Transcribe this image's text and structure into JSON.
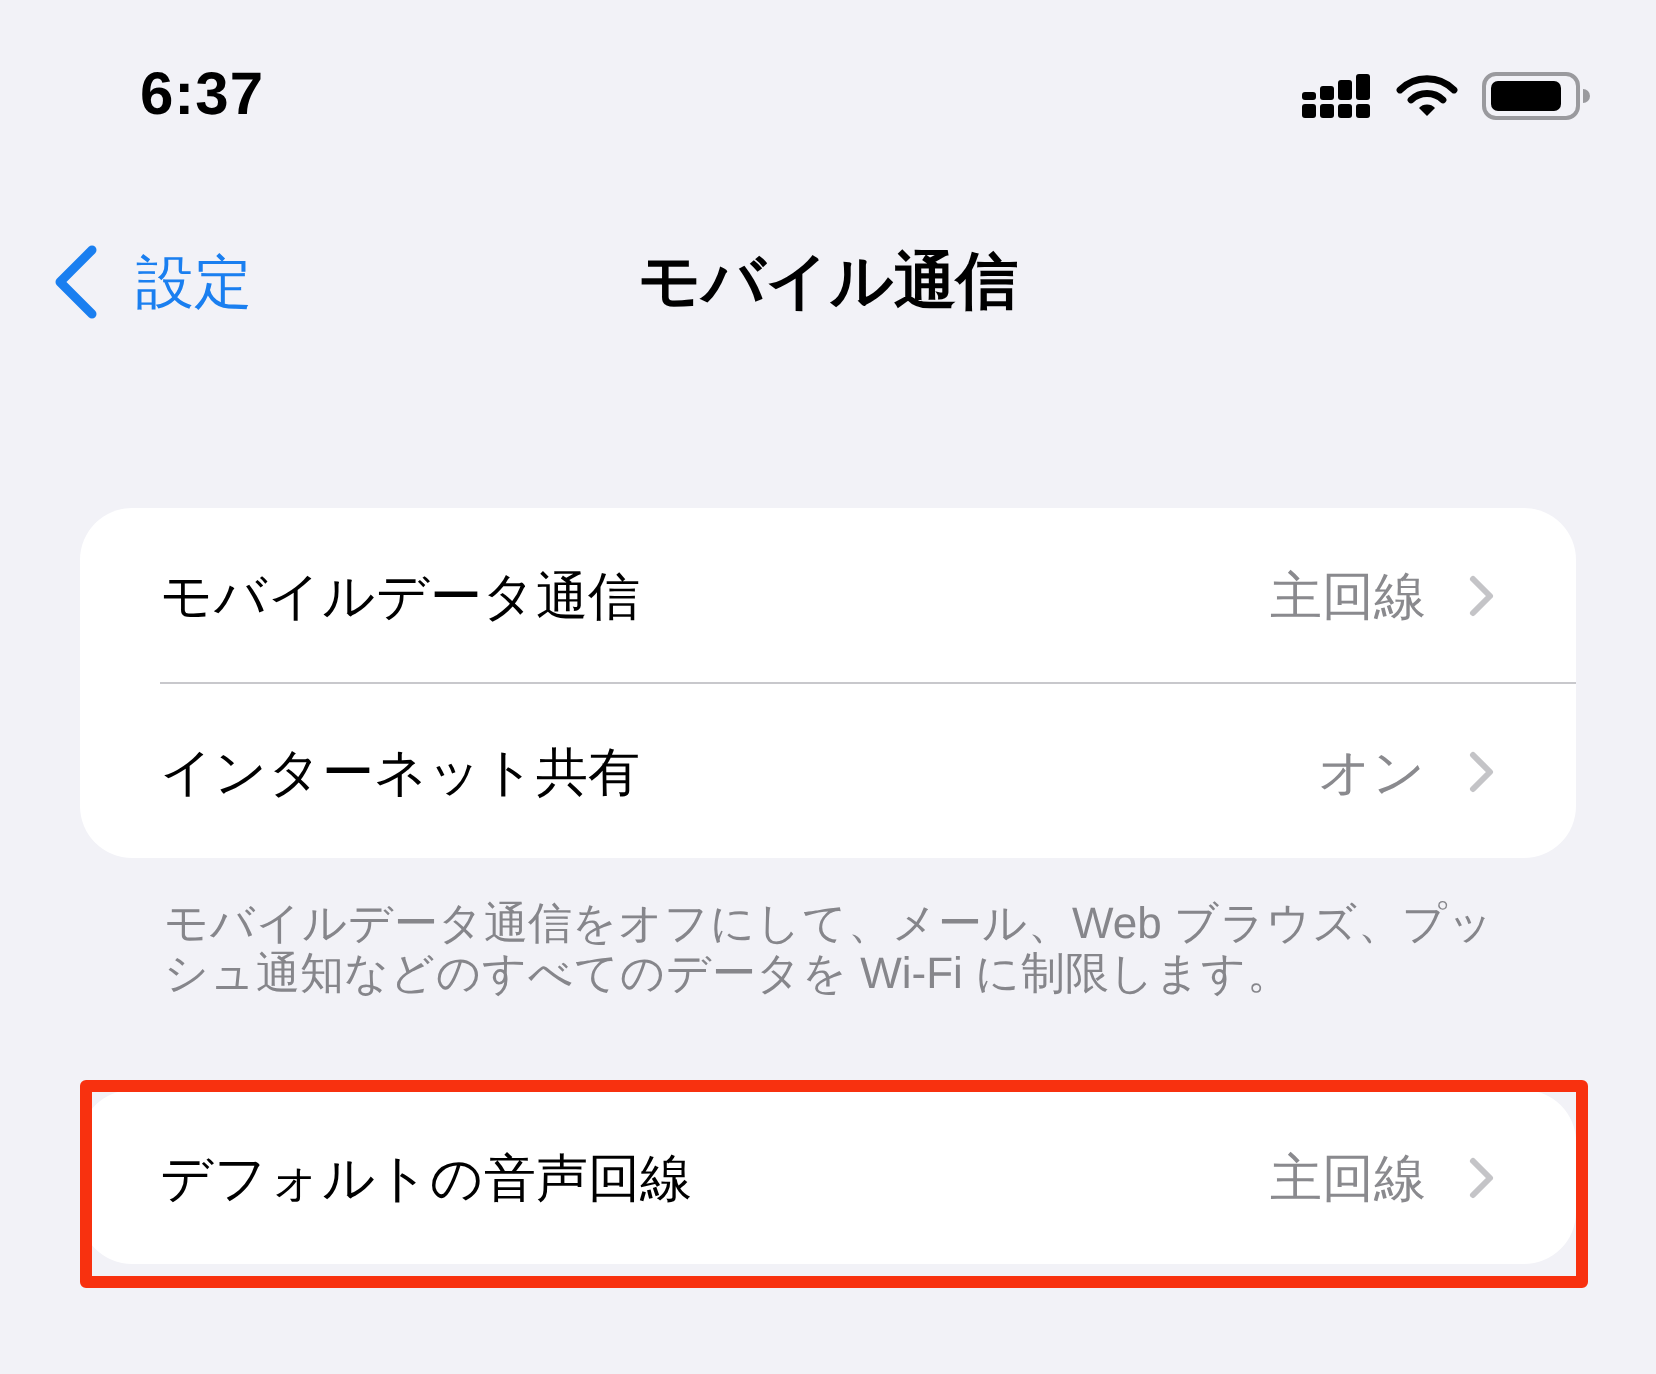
{
  "status_bar": {
    "time": "6:37"
  },
  "nav_bar": {
    "back_label": "設定",
    "title": "モバイル通信"
  },
  "groups": [
    {
      "highlighted": false,
      "rows": [
        {
          "label": "モバイルデータ通信",
          "value": "主回線"
        },
        {
          "label": "インターネット共有",
          "value": "オン"
        }
      ],
      "footer": "モバイルデータ通信をオフにして、メール、Web ブラウズ、プッシュ通知などのすべてのデータを Wi-Fi に制限します。"
    },
    {
      "highlighted": true,
      "rows": [
        {
          "label": "デフォルトの音声回線",
          "value": "主回線"
        }
      ]
    }
  ]
}
